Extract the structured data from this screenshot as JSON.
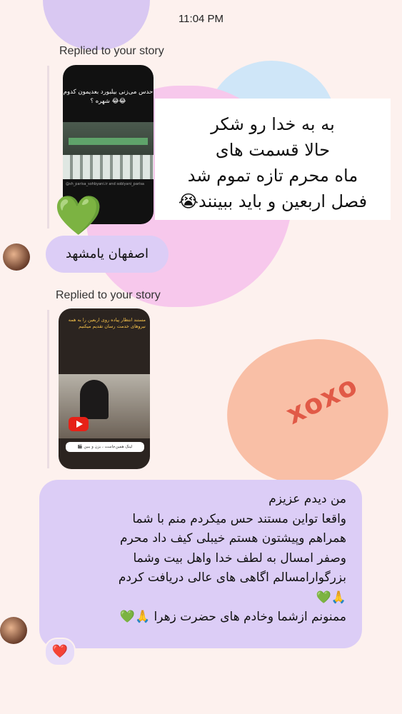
{
  "status_bar": {
    "time": "11:04 PM"
  },
  "background": {
    "sticker_text": "xoxo"
  },
  "messages": [
    {
      "replied_label": "Replied to your story",
      "story": {
        "caption": "حدس می‌زنی بیلبورد بعدیمون کدوم شهره ؟ 😂😂",
        "credit": "@sh_parisa_sohbyani.ir and soblyani_parisa"
      },
      "reply_lines": [
        "به به خدا رو شکر",
        "حالا قسمت های",
        "ماه محرم تازه تموم شد",
        "فصل اربعین و باید ببینند😭"
      ],
      "reaction_emoji": "💚",
      "bubble_text": "اصفهان یامشهد"
    },
    {
      "replied_label": "Replied to your story",
      "story": {
        "overlay_text": "مستند انتظار پیاده روی اربعین را به همه نیروهای خدمت رسان تقدیم میکنیم",
        "link_text": "لینک همین‌جاست ، بزن و ببین 🎬"
      },
      "bubble_lines": [
        "من دیدم عزیزم",
        "واقعا تواین مستند حس میکردم منم با شما",
        "همراهم وپیشتون هستم خیبلی کیف داد محرم",
        "وصفر امسال به لطف خدا واهل بیت وشما",
        "بزرگوارامسالم اگاهی های عالی دریافت کردم",
        "🙏💚",
        "ممنونم ازشما وخادم های حضرت زهرا 🙏💚"
      ],
      "reaction": "❤️"
    }
  ],
  "colors": {
    "bubble": "#dccdf6",
    "background": "#fdf1ee"
  }
}
